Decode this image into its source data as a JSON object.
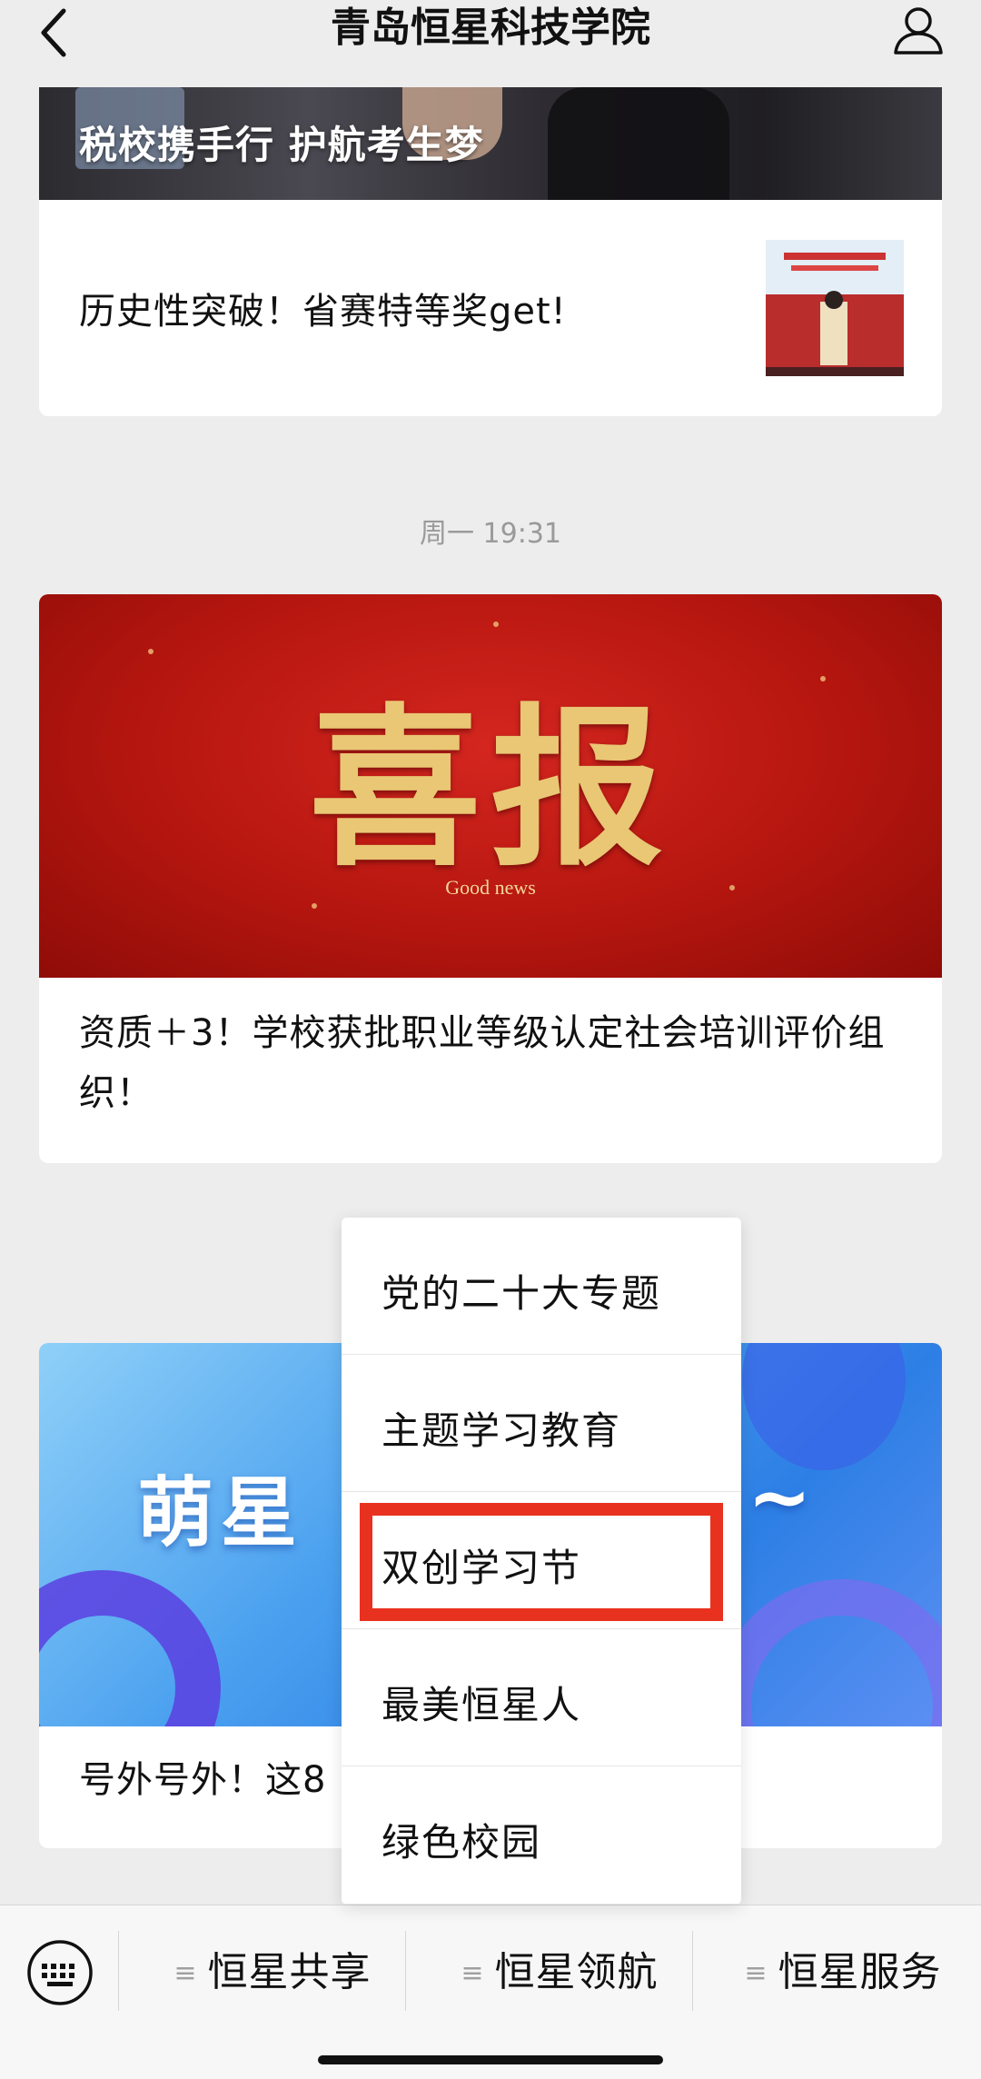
{
  "header": {
    "title": "青岛恒星科技学院",
    "back_icon": "back-chevron-icon",
    "profile_icon": "user-profile-icon"
  },
  "feed": {
    "card1": {
      "cover_caption": "税校携手行 护航考生梦",
      "headline": "历史性突破！省赛特等奖get!"
    },
    "timestamp": "周一 19:31",
    "card2": {
      "cover_art_text": "喜报",
      "cover_art_subtext": "Good news",
      "title": "资质＋3！学校获批职业等级认定社会培训评价组织！"
    },
    "card3": {
      "cover_text_left": "萌星",
      "cover_text_right": "~",
      "title": "号外号外！这8"
    }
  },
  "popup_menu": {
    "items": [
      {
        "label": "党的二十大专题"
      },
      {
        "label": "主题学习教育"
      },
      {
        "label": "双创学习节"
      },
      {
        "label": "最美恒星人"
      },
      {
        "label": "绿色校园"
      }
    ],
    "highlight_color": "#e8311f"
  },
  "bottom_menu": {
    "keyboard_icon": "keyboard-icon",
    "menu_icon": "menu-lines-icon",
    "items": [
      {
        "label": "恒星共享"
      },
      {
        "label": "恒星领航"
      },
      {
        "label": "恒星服务"
      }
    ]
  }
}
